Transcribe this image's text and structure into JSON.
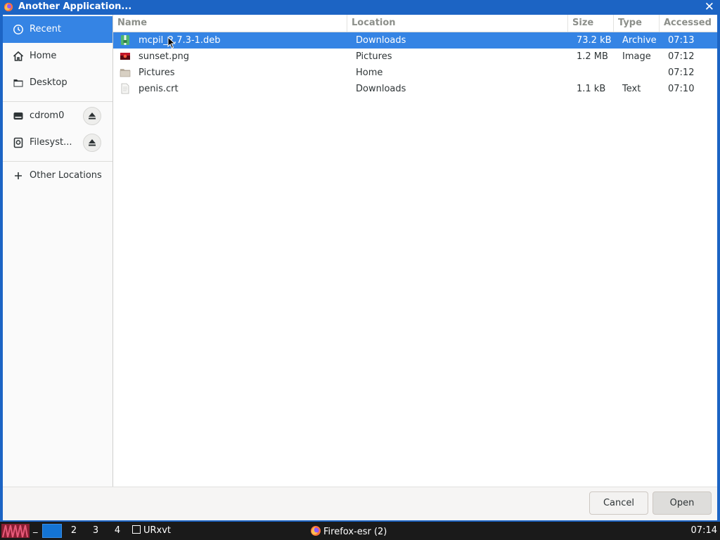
{
  "window": {
    "title": "Another Application...",
    "close_glyph": "✕"
  },
  "sidebar": {
    "items": [
      {
        "label": "Recent",
        "icon": "clock-icon"
      },
      {
        "label": "Home",
        "icon": "home-icon"
      },
      {
        "label": "Desktop",
        "icon": "folder-icon"
      },
      {
        "label": "cdrom0",
        "icon": "drive-icon"
      },
      {
        "label": "Filesyst...",
        "icon": "disk-icon"
      },
      {
        "label": "Other Locations",
        "icon": "plus-icon"
      }
    ]
  },
  "columns": {
    "name": "Name",
    "location": "Location",
    "size": "Size",
    "type": "Type",
    "accessed": "Accessed"
  },
  "files": [
    {
      "name": "mcpil_2.7.3-1.deb",
      "location": "Downloads",
      "size": "73.2 kB",
      "type": "Archive",
      "accessed": "07:13",
      "icon": "package-icon"
    },
    {
      "name": "sunset.png",
      "location": "Pictures",
      "size": "1.2 MB",
      "type": "Image",
      "accessed": "07:12",
      "icon": "image-icon"
    },
    {
      "name": "Pictures",
      "location": "Home",
      "size": "",
      "type": "",
      "accessed": "07:12",
      "icon": "folder-icon"
    },
    {
      "name": "penis.crt",
      "location": "Downloads",
      "size": "1.1 kB",
      "type": "Text",
      "accessed": "07:10",
      "icon": "text-file-icon"
    }
  ],
  "buttons": {
    "cancel": "Cancel",
    "open": "Open"
  },
  "taskbar": {
    "underscore": "_",
    "workspaces": [
      "2",
      "3",
      "4"
    ],
    "windows": [
      {
        "label": "URxvt"
      },
      {
        "label": "Firefox-esr (2)"
      }
    ],
    "clock": "07:14"
  },
  "colors": {
    "accent": "#3584e4",
    "titlebar": "#1c64c4"
  }
}
